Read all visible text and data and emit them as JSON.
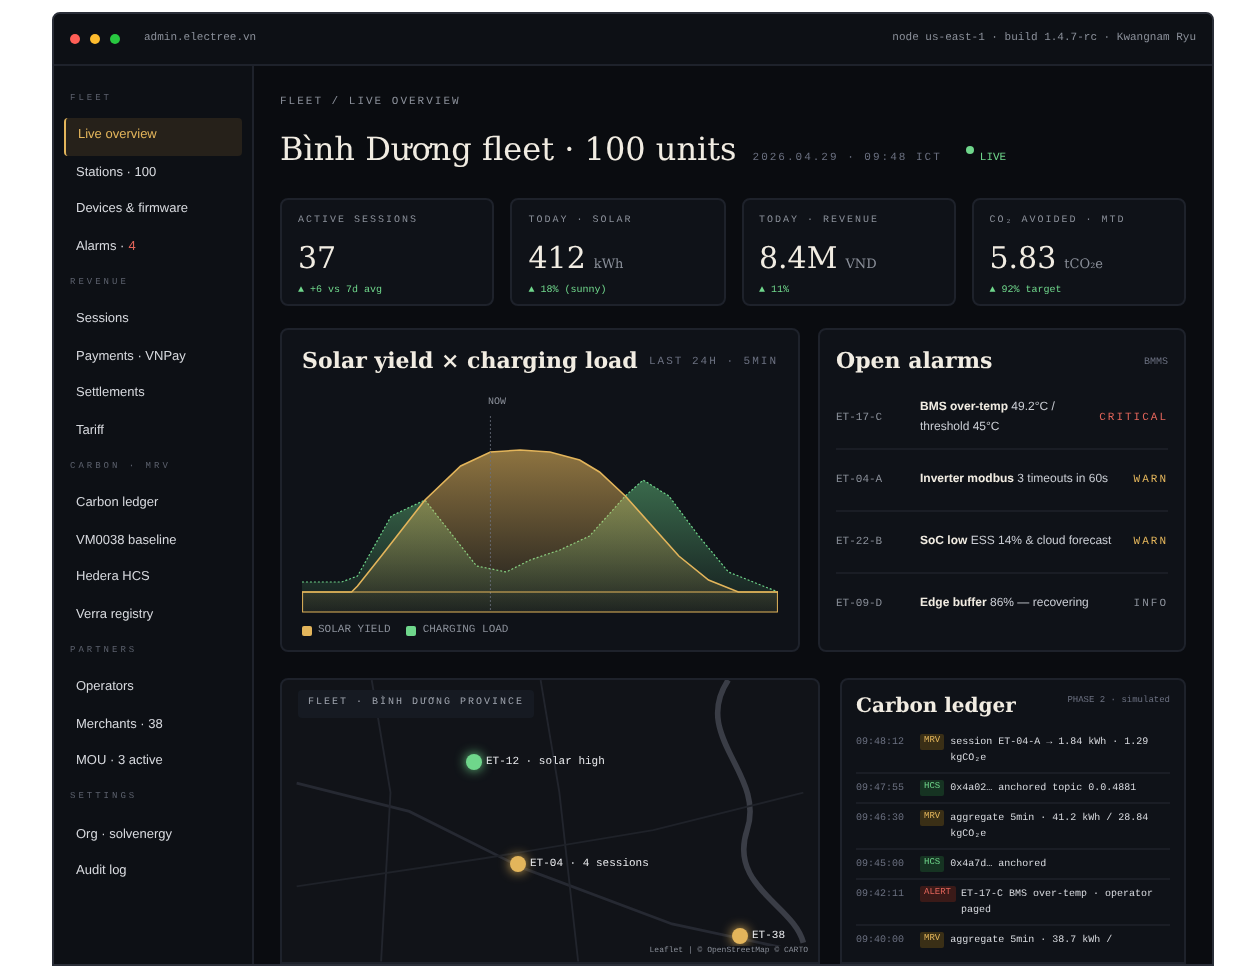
{
  "window": {
    "address": "admin.electree.vn",
    "meta": "node us-east-1 · build 1.4.7-rc · Kwangnam Ryu"
  },
  "sidebar": {
    "sections": [
      {
        "title": "FLEET",
        "items": [
          {
            "label": "Live overview",
            "selected": true
          },
          {
            "label": "Stations · 100",
            "selected": false
          },
          {
            "label": "Devices & firmware",
            "selected": false
          },
          {
            "label": "Alarms ·",
            "count": "4",
            "selected": false
          }
        ]
      },
      {
        "title": "REVENUE",
        "items": [
          {
            "label": "Sessions",
            "selected": false
          },
          {
            "label": "Payments · VNPay",
            "selected": false
          },
          {
            "label": "Settlements",
            "selected": false
          },
          {
            "label": "Tariff",
            "selected": false
          }
        ]
      },
      {
        "title": "CARBON · MRV",
        "items": [
          {
            "label": "Carbon ledger",
            "selected": false
          },
          {
            "label": "VM0038 baseline",
            "selected": false
          },
          {
            "label": "Hedera HCS",
            "selected": false
          },
          {
            "label": "Verra registry",
            "selected": false
          }
        ]
      },
      {
        "title": "PARTNERS",
        "items": [
          {
            "label": "Operators",
            "selected": false
          },
          {
            "label": "Merchants · 38",
            "selected": false
          },
          {
            "label": "MOU · 3 active",
            "selected": false
          }
        ]
      },
      {
        "title": "SETTINGS",
        "items": [
          {
            "label": "Org · solvenergy",
            "selected": false
          },
          {
            "label": "Audit log",
            "selected": false
          }
        ]
      }
    ]
  },
  "header": {
    "breadcrumb": "FLEET / LIVE OVERVIEW",
    "title": "Bình Dương fleet · 100 units",
    "timestamp": "2026.04.29 · 09:48 ICT",
    "status": "LIVE"
  },
  "stats": [
    {
      "label": "ACTIVE SESSIONS",
      "value": "37",
      "delta": "▲ +6 vs 7d avg"
    },
    {
      "label": "TODAY · SOLAR",
      "value": "412",
      "unit": "kWh",
      "delta": "▲ 18% (sunny)"
    },
    {
      "label": "TODAY · REVENUE",
      "value": "8.4M",
      "unit": "VND",
      "delta": "▲ 11%"
    },
    {
      "label": "CO₂ AVOIDED · MTD",
      "value": "5.83",
      "unit": "tCO₂e",
      "delta": "▲ 92% target"
    }
  ],
  "chart": {
    "title": "Solar yield × charging load",
    "range": "LAST 24H · 5MIN",
    "now_label": "NOW",
    "legend": [
      {
        "label": "SOLAR YIELD",
        "color": "#e3b55b"
      },
      {
        "label": "CHARGING LOAD",
        "color": "#6fd68b"
      }
    ]
  },
  "alarms": {
    "title": "Open alarms",
    "source": "BMMS",
    "items": [
      {
        "id": "ET-17-C",
        "text": "**BMS over-temp** 49.2°C / threshold 45°C",
        "severity": "CRITICAL",
        "kind": "critical"
      },
      {
        "id": "ET-04-A",
        "text": "**Inverter modbus** 3 timeouts in 60s",
        "severity": "WARN",
        "kind": "warn"
      },
      {
        "id": "ET-22-B",
        "text": "**SoC low** ESS 14% & cloud forecast",
        "severity": "WARN",
        "kind": "warn"
      },
      {
        "id": "ET-09-D",
        "text": "**Edge buffer** 86% — recovering",
        "severity": "INFO",
        "kind": "info"
      }
    ]
  },
  "map": {
    "title": "FLEET · BÌNH DƯƠNG PROVINCE",
    "attribution": "Leaflet | © OpenStreetMap © CARTO",
    "markers": [
      {
        "label": "ET-12 · solar high",
        "color": "#6fd68b"
      },
      {
        "label": "ET-04 · 4 sessions",
        "color": "#e3b55b"
      },
      {
        "label": "ET-38",
        "color": "#e3b55b"
      }
    ]
  },
  "ledger": {
    "title": "Carbon ledger",
    "phase": "PHASE 2 · simulated",
    "entries": [
      {
        "time": "09:48:12",
        "tag": "MRV",
        "kind": "mrv",
        "text": "session ET-04-A → 1.84 kWh · 1.29 kgCO₂e"
      },
      {
        "time": "09:47:55",
        "tag": "HCS",
        "kind": "hcs",
        "text": "0x4a02… anchored topic 0.0.4881"
      },
      {
        "time": "09:46:30",
        "tag": "MRV",
        "kind": "mrv",
        "text": "aggregate 5min · 41.2 kWh / 28.84 kgCO₂e"
      },
      {
        "time": "09:45:00",
        "tag": "HCS",
        "kind": "hcs",
        "text": "0x4a7d… anchored"
      },
      {
        "time": "09:42:11",
        "tag": "ALERT",
        "kind": "alert",
        "text": "ET-17-C BMS over-temp · operator paged"
      },
      {
        "time": "09:40:00",
        "tag": "MRV",
        "kind": "mrv",
        "text": "aggregate 5min · 38.7 kWh /"
      }
    ]
  }
}
